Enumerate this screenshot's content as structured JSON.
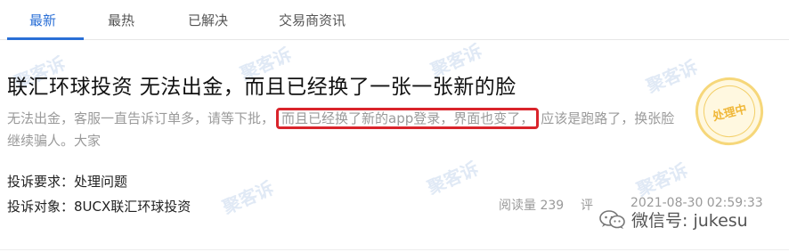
{
  "tabs": [
    {
      "label": "最新",
      "active": true
    },
    {
      "label": "最热",
      "active": false
    },
    {
      "label": "已解决",
      "active": false
    },
    {
      "label": "交易商资讯",
      "active": false
    }
  ],
  "card": {
    "title": "联汇环球投资 无法出金，而且已经换了一张一张新的脸",
    "summary_before": "无法出金，客服一直告诉订单多，请等下批，",
    "summary_highlight": "而且已经换了新的app登录，界面也变了，",
    "summary_after": "应该是跑路了，换张脸继续骗人。大家",
    "request_label": "投诉要求：",
    "request_value": "处理问题",
    "target_label": "投诉对象：",
    "target_value": "8UCX联汇环球投资",
    "reads_label": "阅读量",
    "reads_value": "239",
    "comment_label": "评",
    "timestamp": "2021-08-30 02:59:33",
    "status_stamp": "处理中"
  },
  "watermark_text": "聚客诉",
  "footer": {
    "wechat_text": "微信号: jukesu"
  },
  "colors": {
    "accent": "#2a6fd6",
    "highlight_border": "#d9242b",
    "stamp": "#f0b83a"
  }
}
